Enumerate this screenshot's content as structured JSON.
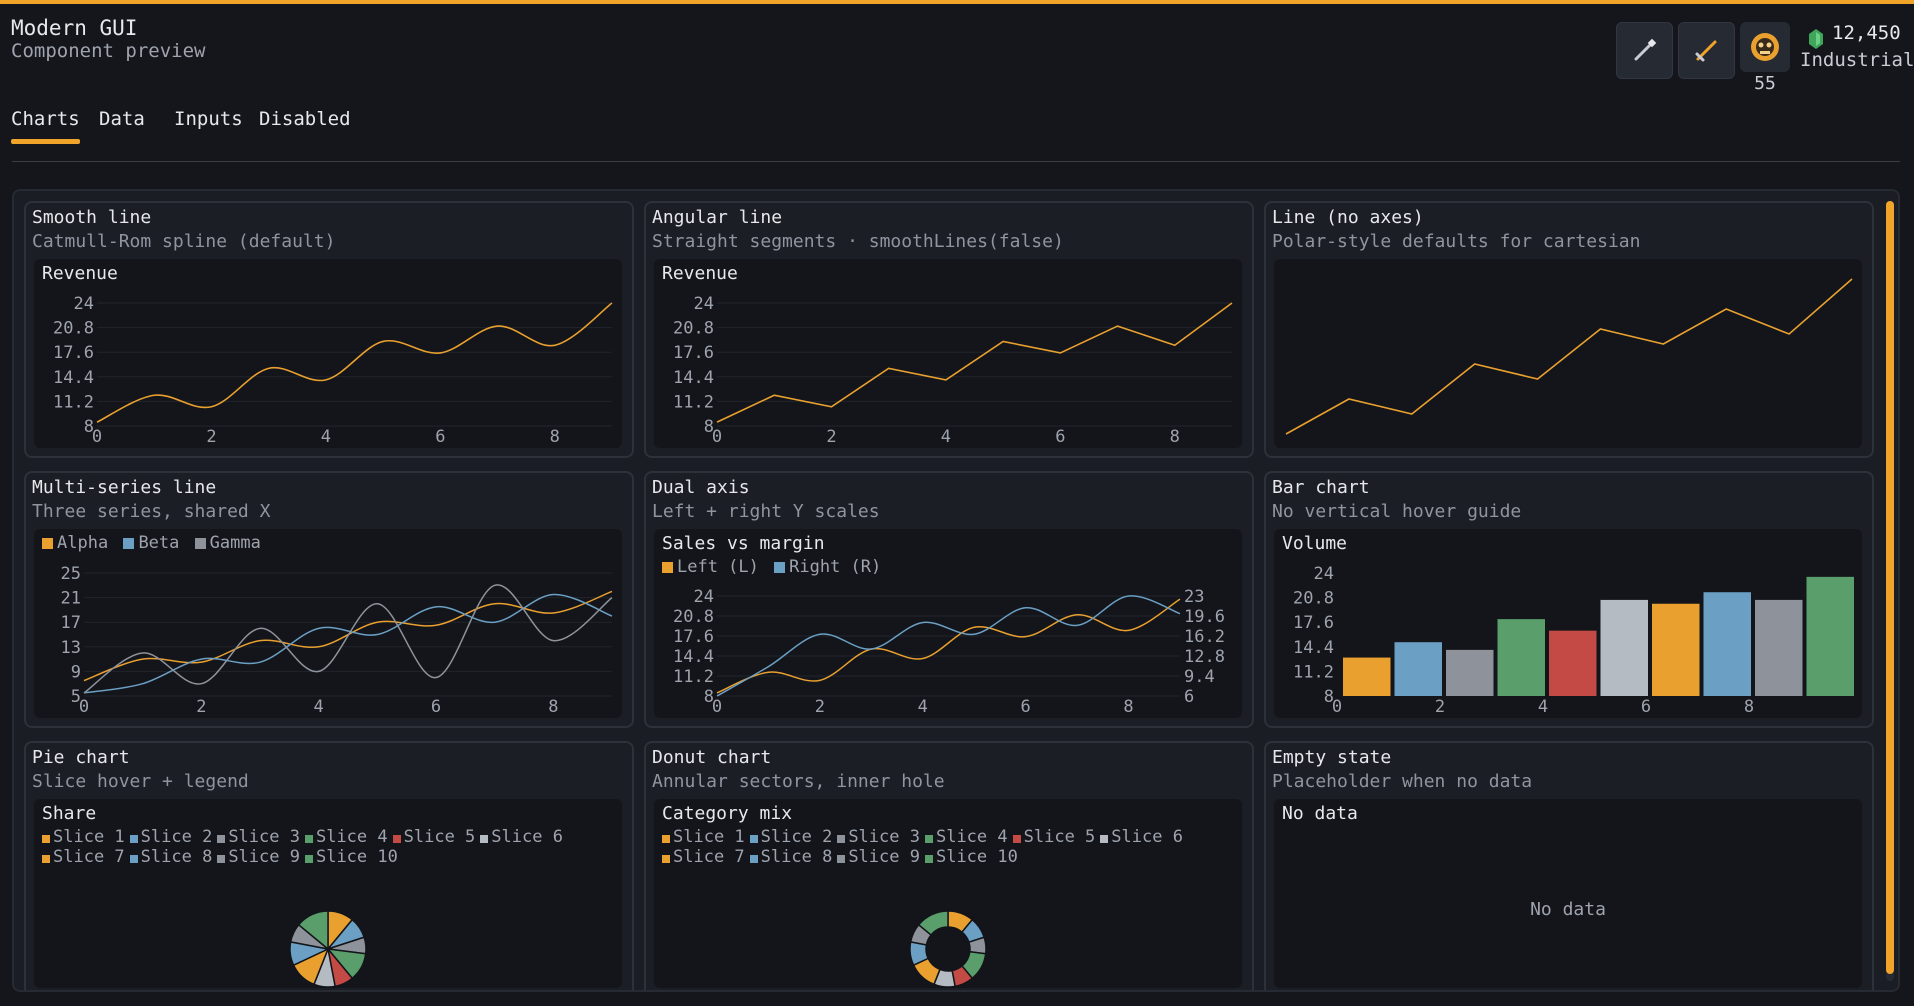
{
  "app": {
    "title": "Modern GUI",
    "subtitle": "Component preview"
  },
  "tabs": [
    "Charts",
    "Data",
    "Inputs",
    "Disabled"
  ],
  "header": {
    "level": "55",
    "currency": "12,450",
    "rank": "Industrial"
  },
  "colors": {
    "accent": "#f0a52a",
    "orange": "#e9a02f",
    "blue": "#6b9fc4",
    "gray": "#8e939b",
    "green": "#5a9e6c",
    "red": "#c44a45",
    "light": "#b5bbc3",
    "axis": "#9ea3ad"
  },
  "cards": [
    {
      "title": "Smooth line",
      "subtitle": "Catmull-Rom spline (default)"
    },
    {
      "title": "Angular line",
      "subtitle": "Straight segments · smoothLines(false)"
    },
    {
      "title": "Line (no axes)",
      "subtitle": "Polar-style defaults for cartesian"
    },
    {
      "title": "Multi-series line",
      "subtitle": "Three series, shared X"
    },
    {
      "title": "Dual axis",
      "subtitle": "Left + right Y scales"
    },
    {
      "title": "Bar chart",
      "subtitle": "No vertical hover guide"
    },
    {
      "title": "Pie chart",
      "subtitle": "Slice hover + legend"
    },
    {
      "title": "Donut chart",
      "subtitle": "Annular sectors, inner hole"
    },
    {
      "title": "Empty state",
      "subtitle": "Placeholder when no data"
    }
  ],
  "chart_data": [
    {
      "type": "line",
      "title": "Revenue",
      "smooth": true,
      "x": [
        0,
        1,
        2,
        3,
        4,
        5,
        6,
        7,
        8,
        9
      ],
      "values": [
        8.5,
        12,
        10.5,
        15.5,
        14,
        19,
        17.5,
        21,
        18.5,
        24
      ],
      "ylim": [
        8,
        24
      ],
      "yticks": [
        "24",
        "20.8",
        "17.6",
        "14.4",
        "11.2",
        "8"
      ],
      "xticks": [
        "0",
        "2",
        "4",
        "6",
        "8"
      ],
      "color": "#e9a02f"
    },
    {
      "type": "line",
      "title": "Revenue",
      "smooth": false,
      "x": [
        0,
        1,
        2,
        3,
        4,
        5,
        6,
        7,
        8,
        9
      ],
      "values": [
        8.5,
        12,
        10.5,
        15.5,
        14,
        19,
        17.5,
        21,
        18.5,
        24
      ],
      "ylim": [
        8,
        24
      ],
      "yticks": [
        "24",
        "20.8",
        "17.6",
        "14.4",
        "11.2",
        "8"
      ],
      "xticks": [
        "0",
        "2",
        "4",
        "6",
        "8"
      ],
      "color": "#e9a02f"
    },
    {
      "type": "line",
      "title": "",
      "axes": false,
      "x": [
        0,
        1,
        2,
        3,
        4,
        5,
        6,
        7,
        8,
        9
      ],
      "values": [
        8.5,
        12,
        10.5,
        15.5,
        14,
        19,
        17.5,
        21,
        18.5,
        24
      ],
      "ylim": [
        8,
        24
      ],
      "color": "#e9a02f"
    },
    {
      "type": "line",
      "title": "",
      "x": [
        0,
        1,
        2,
        3,
        4,
        5,
        6,
        7,
        8,
        9
      ],
      "series": [
        {
          "name": "Alpha",
          "color": "#e9a02f",
          "values": [
            7.5,
            11,
            10.5,
            14,
            13,
            17,
            16.5,
            20,
            18.5,
            22
          ]
        },
        {
          "name": "Beta",
          "color": "#6b9fc4",
          "values": [
            5.5,
            7,
            11,
            10.5,
            16,
            15,
            19.5,
            17,
            21.5,
            18
          ]
        },
        {
          "name": "Gamma",
          "color": "#8e939b",
          "values": [
            5.5,
            12,
            7,
            16,
            9,
            20,
            8,
            23,
            14,
            21
          ]
        }
      ],
      "ylim": [
        5,
        25
      ],
      "yticks": [
        "25",
        "21",
        "17",
        "13",
        "9",
        "5"
      ],
      "xticks": [
        "0",
        "2",
        "4",
        "6",
        "8"
      ]
    },
    {
      "type": "line",
      "title": "Sales vs margin",
      "x": [
        0,
        1,
        2,
        3,
        4,
        5,
        6,
        7,
        8,
        9
      ],
      "series": [
        {
          "name": "Left (L)",
          "axis": "left",
          "color": "#e9a02f",
          "values": [
            8.5,
            11.8,
            10.5,
            15.5,
            14,
            19,
            17.5,
            21,
            18.5,
            23.5
          ]
        },
        {
          "name": "Right (R)",
          "axis": "right",
          "color": "#6b9fc4",
          "values": [
            6,
            11,
            16.5,
            14,
            18.5,
            16.5,
            21,
            18,
            23,
            20
          ]
        }
      ],
      "ylim": [
        8,
        24
      ],
      "yticks": [
        "24",
        "20.8",
        "17.6",
        "14.4",
        "11.2",
        "8"
      ],
      "ylim_right": [
        6,
        23
      ],
      "yticks_right": [
        "23",
        "19.6",
        "16.2",
        "12.8",
        "9.4",
        "6"
      ],
      "xticks": [
        "0",
        "2",
        "4",
        "6",
        "8"
      ]
    },
    {
      "type": "bar",
      "title": "Volume",
      "categories": [
        0,
        1,
        2,
        3,
        4,
        5,
        6,
        7,
        8,
        9
      ],
      "values": [
        13,
        15,
        14,
        18,
        16.5,
        20.5,
        20,
        21.5,
        20.5,
        23.5
      ],
      "ylim": [
        8,
        24
      ],
      "yticks": [
        "24",
        "20.8",
        "17.6",
        "14.4",
        "11.2",
        "8"
      ],
      "xticks": [
        "0",
        "2",
        "4",
        "6",
        "8"
      ],
      "bar_colors": [
        "#e9a02f",
        "#6b9fc4",
        "#8e939b",
        "#5a9e6c",
        "#c44a45",
        "#b5bbc3",
        "#e9a02f",
        "#6b9fc4",
        "#8e939b",
        "#5a9e6c"
      ]
    },
    {
      "type": "pie",
      "title": "Share",
      "labels": [
        "Slice 1",
        "Slice 2",
        "Slice 3",
        "Slice 4",
        "Slice 5",
        "Slice 6",
        "Slice 7",
        "Slice 8",
        "Slice 9",
        "Slice 10"
      ],
      "values": [
        11,
        9,
        7,
        12,
        8,
        9,
        12,
        10,
        8,
        14
      ],
      "colors": [
        "#e9a02f",
        "#6b9fc4",
        "#8e939b",
        "#5a9e6c",
        "#c44a45",
        "#b5bbc3",
        "#e9a02f",
        "#6b9fc4",
        "#8e939b",
        "#5a9e6c"
      ]
    },
    {
      "type": "pie",
      "donut": true,
      "title": "Category mix",
      "labels": [
        "Slice 1",
        "Slice 2",
        "Slice 3",
        "Slice 4",
        "Slice 5",
        "Slice 6",
        "Slice 7",
        "Slice 8",
        "Slice 9",
        "Slice 10"
      ],
      "values": [
        11,
        9,
        7,
        12,
        8,
        9,
        12,
        10,
        8,
        14
      ],
      "colors": [
        "#e9a02f",
        "#6b9fc4",
        "#8e939b",
        "#5a9e6c",
        "#c44a45",
        "#b5bbc3",
        "#e9a02f",
        "#6b9fc4",
        "#8e939b",
        "#5a9e6c"
      ]
    },
    {
      "type": "empty",
      "title": "No data",
      "message": "No data"
    }
  ]
}
